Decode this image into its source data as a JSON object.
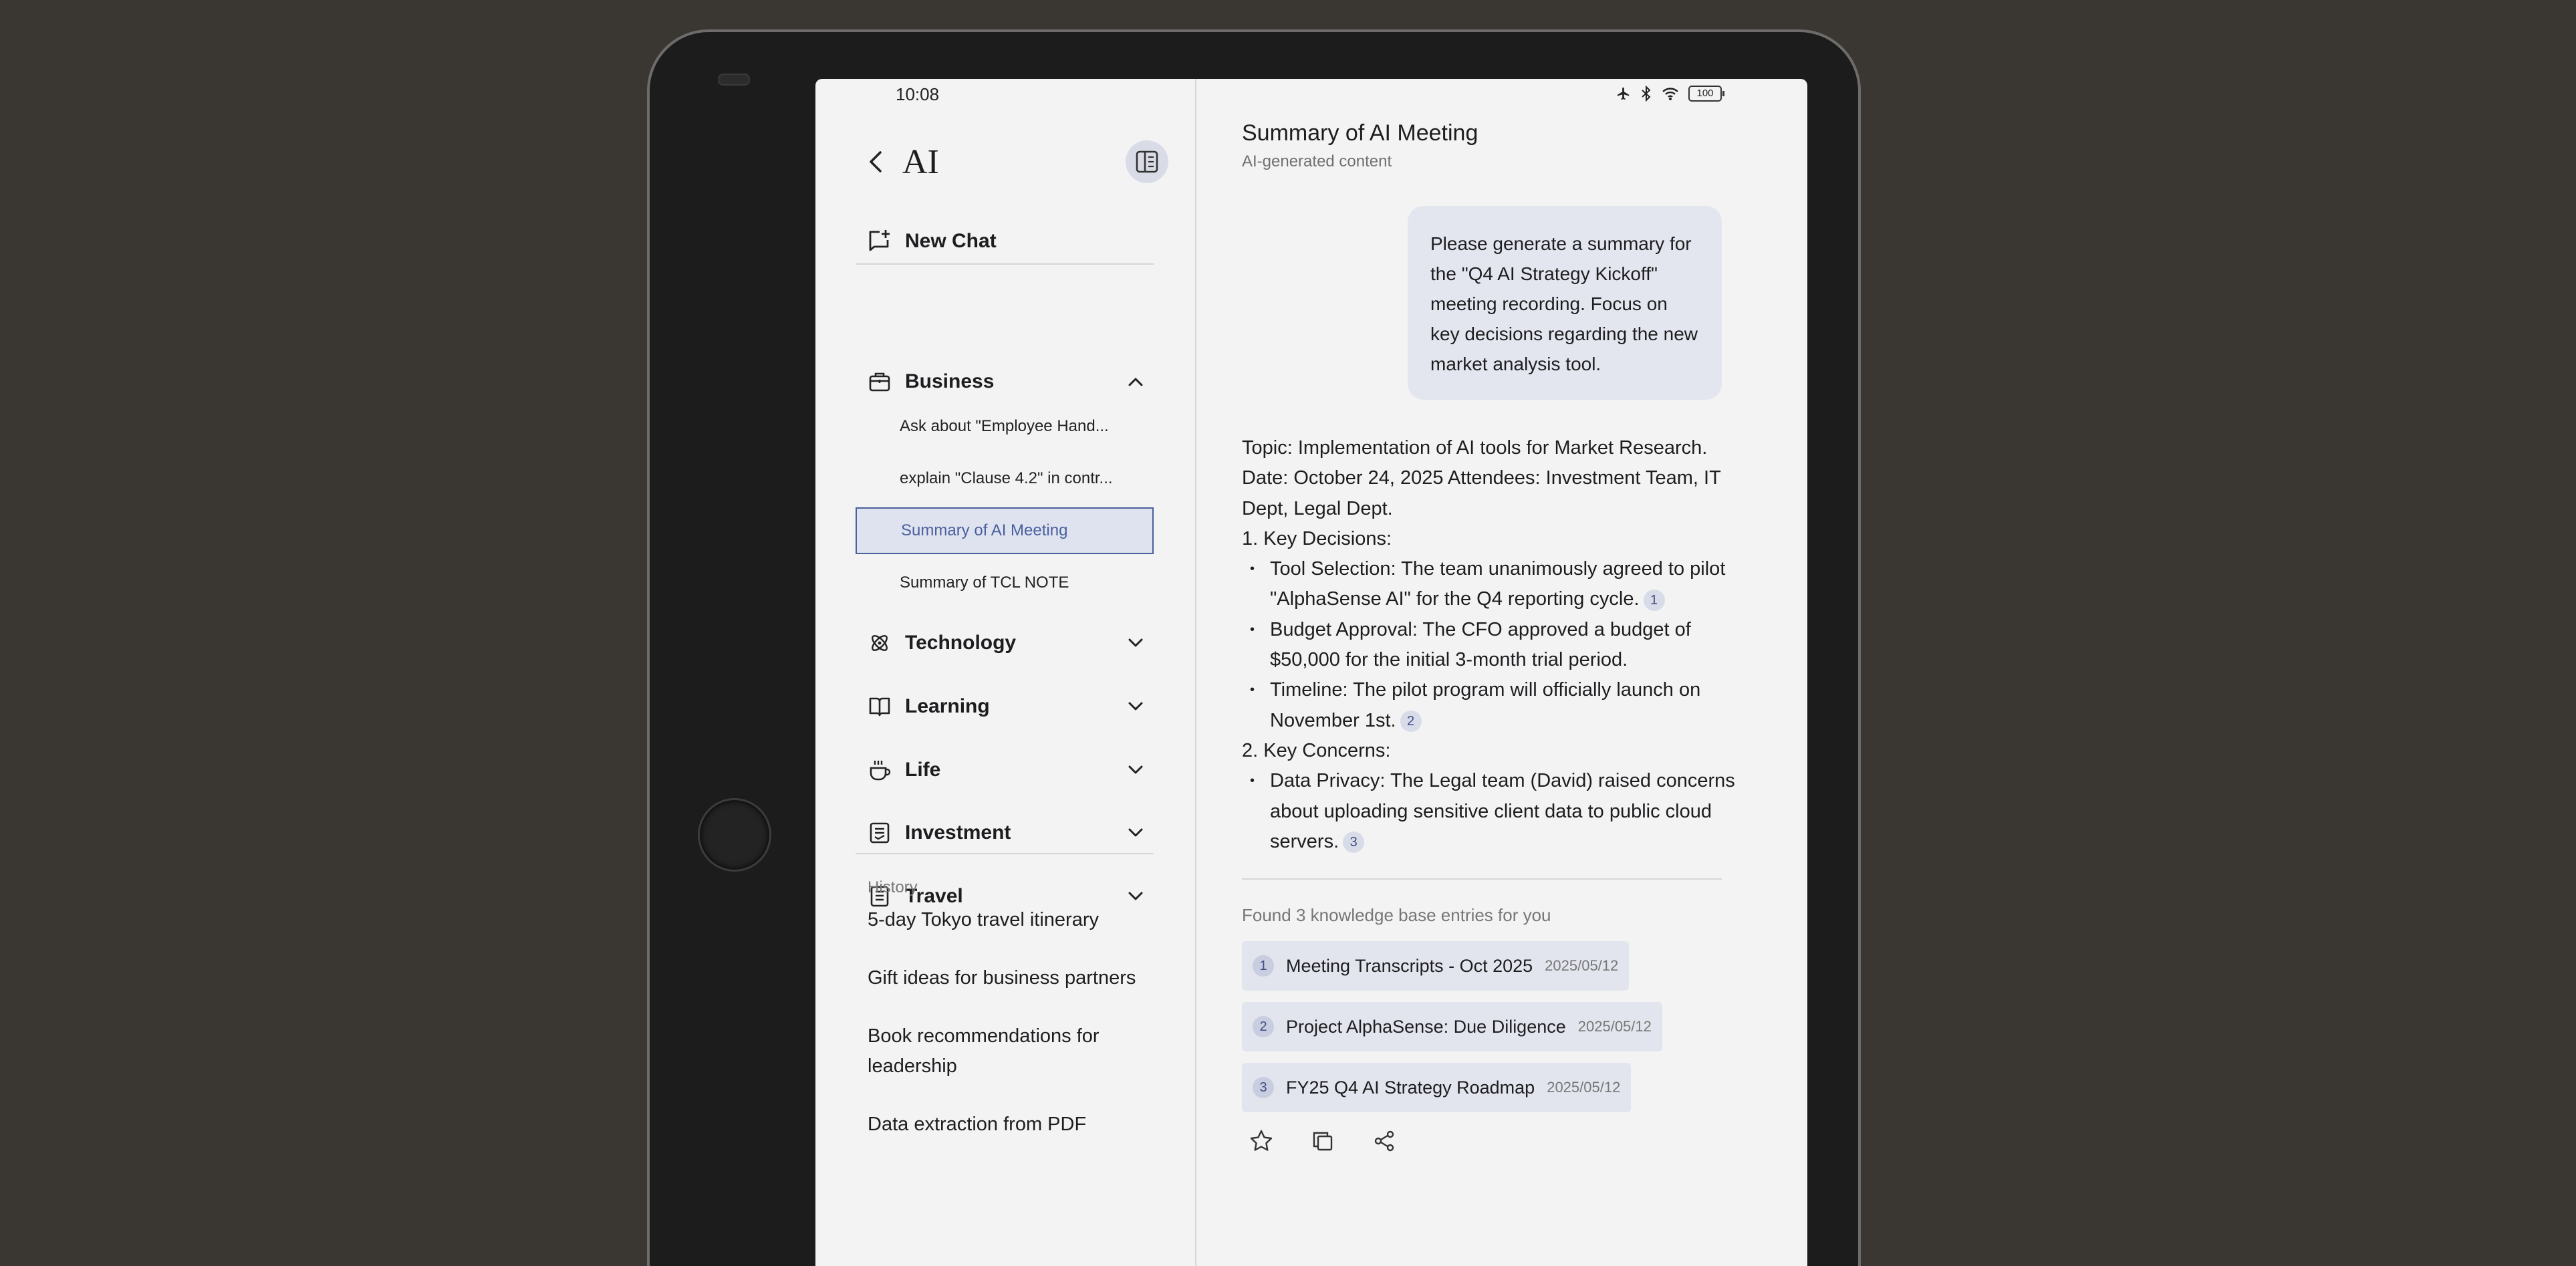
{
  "status": {
    "time": "10:08",
    "battery": "100"
  },
  "sidebar": {
    "title": "AI",
    "new_chat": "New Chat",
    "categories": [
      {
        "label": "Business",
        "icon": "briefcase-icon",
        "expanded": true
      },
      {
        "label": "Technology",
        "icon": "atom-icon"
      },
      {
        "label": "Learning",
        "icon": "book-icon"
      },
      {
        "label": "Life",
        "icon": "coffee-icon"
      },
      {
        "label": "Investment",
        "icon": "ledger-icon"
      },
      {
        "label": "Travel",
        "icon": "luggage-icon"
      }
    ],
    "business_items": [
      "Ask about \"Employee Hand...",
      "explain \"Clause 4.2\" in contr...",
      "Summary of AI Meeting",
      "Summary of TCL NOTE"
    ],
    "history_label": "History",
    "history": [
      "5-day Tokyo travel itinerary",
      "Gift ideas for business partners",
      "Book recommendations for leadership",
      "Data extraction from PDF"
    ]
  },
  "main": {
    "title": "Summary of AI Meeting",
    "subtitle": "AI-generated content",
    "user_message": "Please generate a summary for the \"Q4 AI Strategy Kickoff\" meeting recording. Focus on key decisions regarding the new market analysis tool.",
    "answer": {
      "intro": "Topic: Implementation of AI tools for Market Research. Date: October 24, 2025 Attendees: Investment Team, IT Dept, Legal Dept.",
      "section1": "1. Key Decisions:",
      "b1": "Tool Selection: The team unanimously agreed to pilot \"AlphaSense AI\" for the Q4 reporting cycle.",
      "b1_cite": "1",
      "b2": "Budget Approval: The CFO approved a budget of $50,000 for the initial 3-month trial period.",
      "b3": "Timeline: The pilot program will officially launch on November 1st.",
      "b3_cite": "2",
      "section2": "2. Key Concerns:",
      "b4": "Data Privacy: The Legal team (David) raised concerns about uploading sensitive client data to public cloud servers.",
      "b4_cite": "3"
    },
    "kb_found": "Found 3 knowledge base entries for you",
    "kb_entries": [
      {
        "num": "1",
        "title": "Meeting Transcripts - Oct 2025",
        "date": "2025/05/12"
      },
      {
        "num": "2",
        "title": "Project AlphaSense: Due Diligence",
        "date": "2025/05/12"
      },
      {
        "num": "3",
        "title": "FY25 Q4 AI Strategy Roadmap",
        "date": "2025/05/12"
      }
    ],
    "actions": [
      "star-icon",
      "copy-icon",
      "share-icon"
    ]
  },
  "colors": {
    "accent": "#4a5f9e",
    "chip": "#e2e5ee",
    "background": "#3a3632"
  }
}
